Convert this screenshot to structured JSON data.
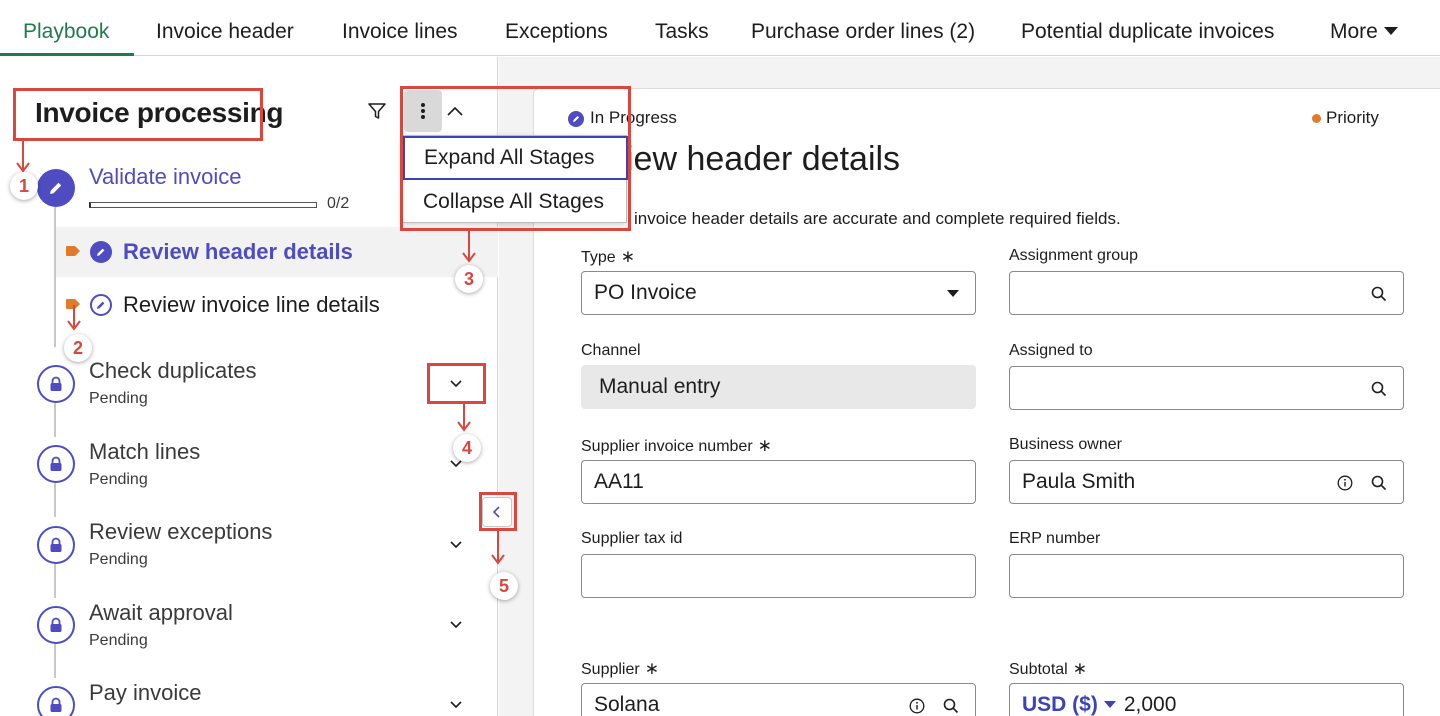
{
  "tabs": [
    {
      "label": "Playbook",
      "active": true
    },
    {
      "label": "Invoice header"
    },
    {
      "label": "Invoice lines"
    },
    {
      "label": "Exceptions"
    },
    {
      "label": "Tasks"
    },
    {
      "label": "Purchase order lines (2)"
    },
    {
      "label": "Potential duplicate invoices"
    },
    {
      "label": "More"
    }
  ],
  "left_panel": {
    "title": "Invoice processing",
    "icons": {
      "filter": "filter-icon",
      "menu": "kebab-menu-icon",
      "collapse": "chevron-up-icon"
    },
    "stages": [
      {
        "name": "Validate invoice",
        "state": "active",
        "progress_text": "0/2",
        "progress_fraction": 0,
        "tasks": [
          {
            "label": "Review header details",
            "active": true
          },
          {
            "label": "Review invoice line details",
            "active": false
          }
        ]
      },
      {
        "name": "Check duplicates",
        "status": "Pending"
      },
      {
        "name": "Match lines",
        "status": "Pending"
      },
      {
        "name": "Review exceptions",
        "status": "Pending"
      },
      {
        "name": "Await approval",
        "status": "Pending"
      },
      {
        "name": "Pay invoice",
        "status": "Pending"
      }
    ]
  },
  "menu": {
    "items": [
      "Expand All Stages",
      "Collapse All Stages"
    ]
  },
  "annotations": [
    "1",
    "2",
    "3",
    "4",
    "5"
  ],
  "detail": {
    "status": "In Progress",
    "priority": "Priority",
    "title": "iew header details",
    "description": "invoice header details are accurate and complete required fields.",
    "fields": {
      "type": {
        "label": "Type",
        "value": "PO Invoice",
        "required": "∗"
      },
      "assignment_group": {
        "label": "Assignment group",
        "value": ""
      },
      "channel": {
        "label": "Channel",
        "value": "Manual entry"
      },
      "assigned_to": {
        "label": "Assigned to",
        "value": ""
      },
      "supplier_invoice_number": {
        "label": "Supplier invoice number",
        "value": "AA11",
        "required": "∗"
      },
      "business_owner": {
        "label": "Business owner",
        "value": "Paula Smith"
      },
      "supplier_tax_id": {
        "label": "Supplier tax id",
        "value": ""
      },
      "erp_number": {
        "label": "ERP number",
        "value": ""
      },
      "supplier": {
        "label": "Supplier",
        "value": "Solana",
        "required": "∗"
      },
      "subtotal": {
        "label": "Subtotal",
        "currency": "USD ($)",
        "value": "2,000",
        "required": "∗"
      }
    }
  },
  "colors": {
    "accent": "#4f4cc1",
    "tab_active": "#217a4e",
    "annotation": "#d9473f",
    "priority": "#e07b2e",
    "task_tag": "#e07b2e"
  }
}
